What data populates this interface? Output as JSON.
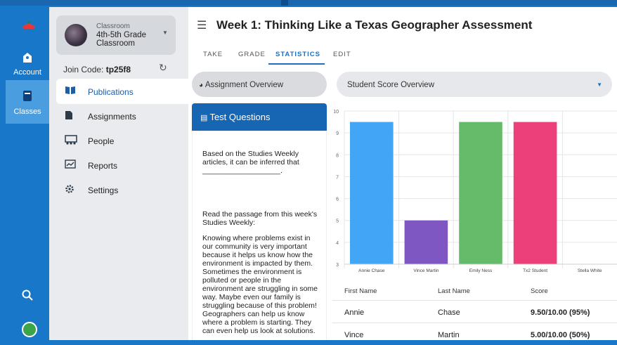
{
  "rail": {
    "account_label": "Account",
    "classes_label": "Classes"
  },
  "class_card": {
    "small_label": "Classroom",
    "name": "4th-5th Grade Classroom"
  },
  "join": {
    "label": "Join Code: ",
    "code": "tp25f8"
  },
  "nav": [
    {
      "label": "Publications",
      "icon": "book-icon"
    },
    {
      "label": "Assignments",
      "icon": "document-icon"
    },
    {
      "label": "People",
      "icon": "people-icon"
    },
    {
      "label": "Reports",
      "icon": "chart-icon"
    },
    {
      "label": "Settings",
      "icon": "gear-icon"
    }
  ],
  "header": {
    "title": "Week 1: Thinking Like a Texas Geographer Assessment"
  },
  "tabs": [
    "TAKE",
    "GRADE",
    "STATISTICS",
    "EDIT"
  ],
  "overview_button": "Assignment Overview",
  "score_select": "Student Score Overview",
  "test_questions": {
    "header": "Test Questions",
    "q1": "Based on the Studies Weekly articles, it can be inferred that ___________________.",
    "q2": "Read the passage from this week's Studies Weekly:",
    "q2_passage": "Knowing where problems exist in our community is very important because it helps us know how the environment is impacted by them. Sometimes the environment is polluted or people in the environment are struggling in some way. Maybe even our family is struggling because of this problem! Geographers can help us know where a problem is starting. They can even help us look at solutions."
  },
  "chart_data": {
    "type": "bar",
    "categories": [
      "Annie Chase",
      "Vince Martin",
      "Emily Ness",
      "Tx2 Student",
      "Stella White"
    ],
    "values": [
      9.5,
      5,
      9.5,
      9.5,
      null
    ],
    "colors": [
      "#42a5f5",
      "#7e57c2",
      "#66bb6a",
      "#ec407a",
      "#ffa726"
    ],
    "ylim": [
      3,
      10
    ],
    "yticks": [
      3,
      4,
      5,
      6,
      7,
      8,
      9,
      10
    ],
    "grid": true
  },
  "table": {
    "headers": [
      "First Name",
      "Last Name",
      "Score"
    ],
    "rows": [
      [
        "Annie",
        "Chase",
        "9.50/10.00 (95%)"
      ],
      [
        "Vince",
        "Martin",
        "5.00/10.00 (50%)"
      ]
    ]
  }
}
